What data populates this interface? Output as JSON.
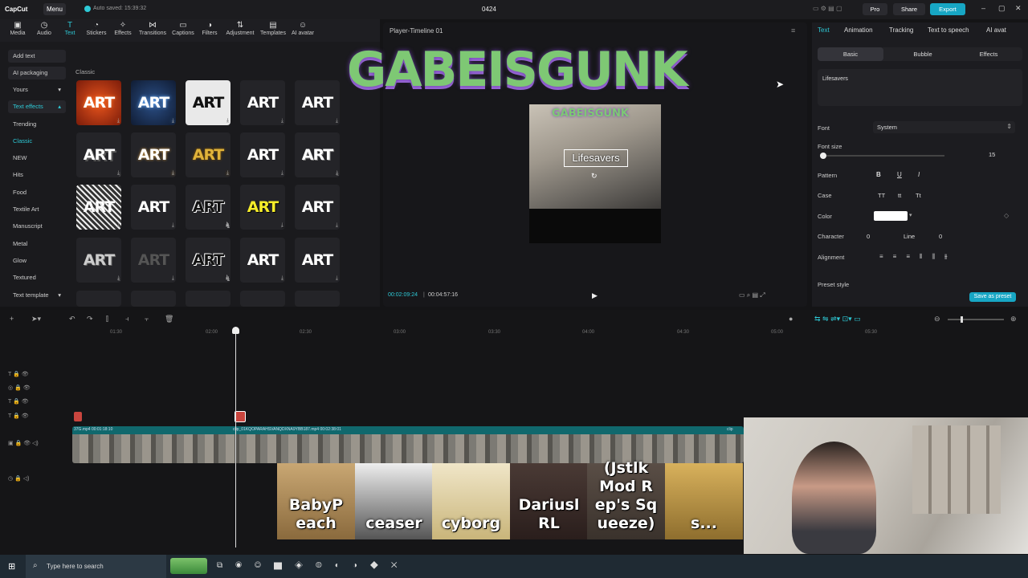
{
  "app": {
    "logo": "CapCut",
    "menu": "Menu",
    "autosave": "Auto saved: 15:39:32",
    "project": "0424",
    "pro": "Pro",
    "share": "Share",
    "export": "Export"
  },
  "toolbar": [
    {
      "icon": "media-icon",
      "label": "Media"
    },
    {
      "icon": "audio-icon",
      "label": "Audio"
    },
    {
      "icon": "text-icon",
      "label": "Text"
    },
    {
      "icon": "stickers-icon",
      "label": "Stickers"
    },
    {
      "icon": "effects-icon",
      "label": "Effects"
    },
    {
      "icon": "transitions-icon",
      "label": "Transitions"
    },
    {
      "icon": "captions-icon",
      "label": "Captions"
    },
    {
      "icon": "filters-icon",
      "label": "Filters"
    },
    {
      "icon": "adjustment-icon",
      "label": "Adjustment"
    },
    {
      "icon": "templates-icon",
      "label": "Templates"
    },
    {
      "icon": "ai-avatar-icon",
      "label": "AI avatar"
    }
  ],
  "leftnav": {
    "add_text": "Add text",
    "ai_packaging": "AI packaging",
    "yours": "Yours",
    "text_effects": "Text effects",
    "trending": "Trending",
    "classic": "Classic",
    "new": "NEW",
    "hits": "Hits",
    "food": "Food",
    "textile": "Textile Art",
    "manuscript": "Manuscript",
    "metal": "Metal",
    "glow": "Glow",
    "textured": "Textured",
    "text_template": "Text template"
  },
  "library": {
    "section": "Classic",
    "tile_text": "ART"
  },
  "player": {
    "title": "Player-Timeline 01",
    "current": "00:02:09:24",
    "total": "00:04:57:16",
    "overlay": "GABEISGUNK",
    "caption": "Lifesavers",
    "video_overlay_text": "GABEISGUNK"
  },
  "rightpanel": {
    "tabs": [
      "Text",
      "Animation",
      "Tracking",
      "Text to speech",
      "AI avat"
    ],
    "subtabs": [
      "Basic",
      "Bubble",
      "Effects"
    ],
    "text_value": "Lifesavers",
    "font_label": "Font",
    "font_value": "System",
    "size_label": "Font size",
    "size_value": "15",
    "pattern_label": "Pattern",
    "case_label": "Case",
    "color_label": "Color",
    "color_value": "#ffffff",
    "character_label": "Character",
    "character_value": "0",
    "line_label": "Line",
    "line_value": "0",
    "alignment_label": "Alignment",
    "preset_label": "Preset style",
    "save_preset": "Save as preset",
    "case_opts": [
      "TT",
      "tt",
      "Tt"
    ],
    "pattern_opts": [
      "B",
      "U",
      "I"
    ]
  },
  "timeline": {
    "ruler": [
      "01:30",
      "02:00",
      "02:30",
      "03:00",
      "03:30",
      "04:00",
      "04:30",
      "05:00",
      "05:30"
    ],
    "clip1": "37G.mp4  00:01:18:10",
    "clip2": "clip_01KQOPARAHSVANQDXNA9YBB187.mp4  00:02:38:01",
    "clip3": "clip"
  },
  "stream": {
    "emotes": [
      "BabyP each",
      "ceaser",
      "cyborg",
      "Dariusl RL",
      "(Jstlk Mod R ep's Sq ueeze)",
      "s..."
    ]
  },
  "taskbar": {
    "search": "Type here to search"
  },
  "colors": {
    "accent": "#2ec9d6",
    "export_bg": "#17a6c4",
    "clip_header": "#10686d",
    "marker": "#c9453e"
  }
}
